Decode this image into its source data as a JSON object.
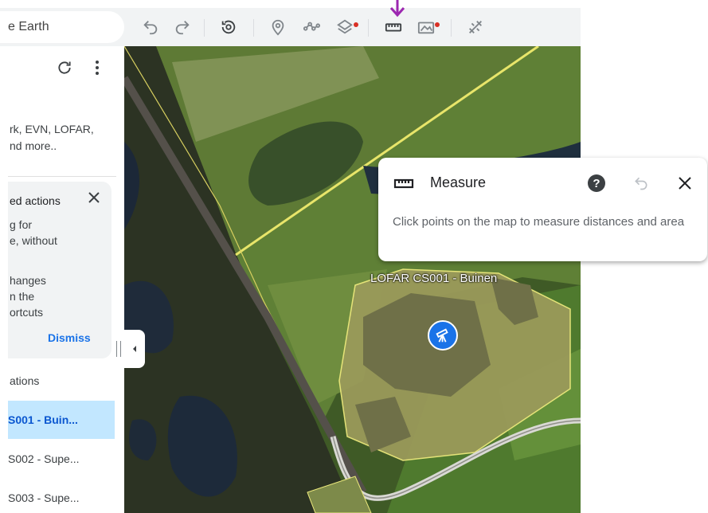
{
  "search": {
    "text": "e Earth"
  },
  "panel": {
    "refresh_icon": "refresh-icon",
    "more_icon": "more-vert-icon",
    "description_line1": "rk, EVN, LOFAR,",
    "description_line2": "nd more..",
    "actions_card": {
      "title": "ed actions",
      "line1": "g for",
      "line2": "e, without",
      "line3": "hanges",
      "line4": "n the",
      "line5": "ortcuts",
      "dismiss_label": "Dismiss"
    },
    "section_label": "ations",
    "items": [
      {
        "label": "S001 - Buin..."
      },
      {
        "label": "S002 - Supe..."
      },
      {
        "label": "S003 - Supe..."
      }
    ]
  },
  "measure": {
    "title": "Measure",
    "description": "Click points on the map to measure distances and area"
  },
  "map": {
    "place_label": "LOFAR CS001 - Buinen"
  },
  "colors": {
    "accent": "#1a73e8",
    "selected_bg": "#c2e7ff",
    "highlight_arrow": "#9c27b0",
    "notification_dot": "#d93025"
  }
}
